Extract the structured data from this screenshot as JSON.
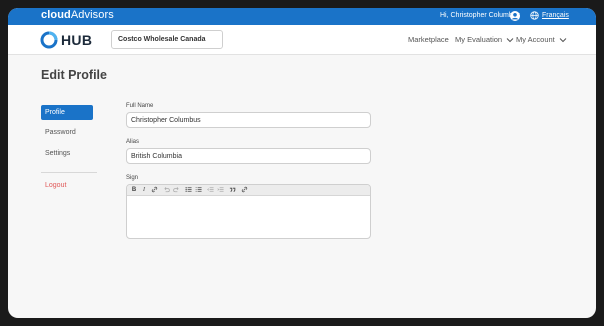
{
  "topbar": {
    "brand_part1": "cloud",
    "brand_part2": "Advisors",
    "greeting": "Hi, Christopher Columbus",
    "language_link": "Français"
  },
  "navbar": {
    "logo_text": "HUB",
    "company": "Costco Wholesale Canada",
    "marketplace": "Marketplace",
    "my_evaluation": "My Evaluation",
    "my_account": "My Account"
  },
  "page": {
    "title": "Edit Profile"
  },
  "sidebar": {
    "items": [
      {
        "label": "Profile",
        "active": true
      },
      {
        "label": "Password",
        "active": false
      },
      {
        "label": "Settings",
        "active": false
      }
    ],
    "logout": "Logout"
  },
  "form": {
    "full_name_label": "Full Name",
    "full_name_value": "Christopher Columbus",
    "alias_label": "Alias",
    "alias_value": "British Columbia",
    "sign_label": "Sign",
    "sign_value": ""
  },
  "editor_toolbar": {
    "bold": "B",
    "italic": "I",
    "icons": [
      "link-icon",
      "undo-icon",
      "redo-icon",
      "bulleted-list-icon",
      "numbered-list-icon",
      "outdent-icon",
      "indent-icon",
      "blockquote-icon",
      "unlink-icon"
    ]
  },
  "colors": {
    "brand_blue": "#1a73c8",
    "logout_red": "#e05858"
  }
}
